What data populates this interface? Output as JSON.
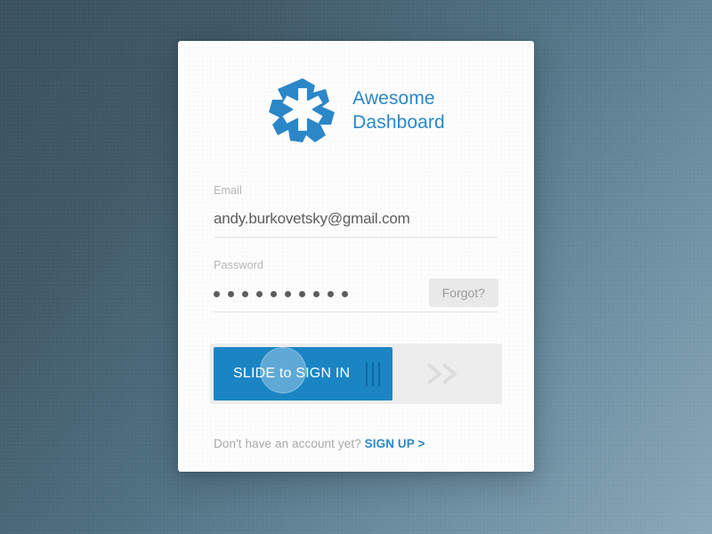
{
  "background": {
    "gradient_from": "#3a5160",
    "gradient_to": "#8aa9b9"
  },
  "brand": {
    "logo_icon": "starburst-asterisk-logo",
    "line1": "Awesome",
    "line2": "Dashboard",
    "color": "#2b87c8"
  },
  "form": {
    "email": {
      "label": "Email",
      "value": "andy.burkovetsky@gmail.com",
      "placeholder": "Email"
    },
    "password": {
      "label": "Password",
      "value": "••••••••••",
      "placeholder": "Password",
      "masked_character_count": 10,
      "forgot_label": "Forgot?"
    }
  },
  "slider": {
    "label": "SLIDE to SIGN IN",
    "fill_color": "#1b85c4",
    "track_color": "#ededed",
    "grip_icon": "drag-grip-lines-icon",
    "chevron_icon": "chevron-double-right-icon",
    "progress_percent": 61
  },
  "footer": {
    "prompt": "Don't have an account yet?",
    "signup_label": "SIGN UP >",
    "signup_color": "#2b87c8"
  }
}
